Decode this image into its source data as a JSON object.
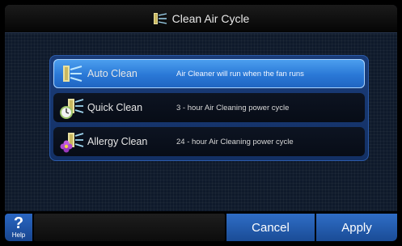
{
  "header": {
    "title": "Clean Air Cycle",
    "icon": "air-cleaner-icon"
  },
  "options": [
    {
      "name": "Auto Clean",
      "description": "Air Cleaner will run when the fan runs",
      "icon": "air-cleaner-icon",
      "selected": true
    },
    {
      "name": "Quick Clean",
      "description": "3 - hour Air Cleaning power cycle",
      "icon": "clock-air-cleaner-icon",
      "selected": false
    },
    {
      "name": "Allergy Clean",
      "description": "24 - hour Air Cleaning power cycle",
      "icon": "flower-air-cleaner-icon",
      "selected": false
    }
  ],
  "footer": {
    "help_symbol": "?",
    "help_label": "Help",
    "cancel_label": "Cancel",
    "apply_label": "Apply"
  },
  "colors": {
    "selected_row": "#3a8be6",
    "panel": "#1a3d7a",
    "button": "#2f6dc6"
  }
}
